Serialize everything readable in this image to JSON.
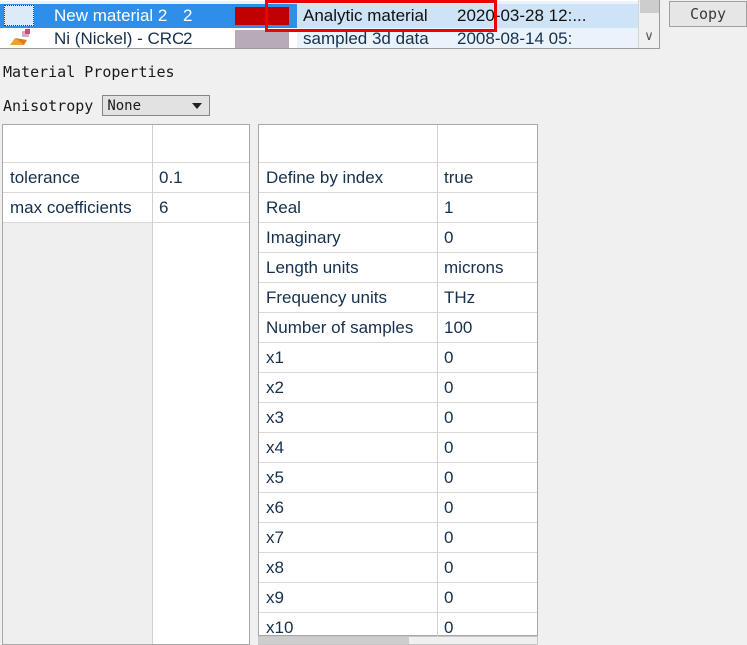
{
  "material_list": {
    "scroll": {
      "down_arrow_glyph": "∨"
    },
    "columns": [
      "icon",
      "name",
      "index",
      "color",
      "type",
      "date"
    ],
    "rows": [
      {
        "name": "New material 2",
        "index": "2",
        "color": "#c00000",
        "type": "Analytic material",
        "date": "2020-03-28 12:...",
        "selected": true
      },
      {
        "name": "Ni (Nickel) - CRC",
        "index": "2",
        "color": "#b9aab8",
        "type": "sampled 3d data",
        "date": "2008-08-14 05:",
        "selected": false
      }
    ]
  },
  "toolbar": {
    "copy_label": "Copy"
  },
  "annotation": {
    "color": "#ee0000",
    "targets": "Analytic material"
  },
  "section": {
    "title": "Material Properties"
  },
  "anisotropy": {
    "label": "Anisotropy",
    "value": "None",
    "options": [
      "None"
    ]
  },
  "fit_table": {
    "header_key": "",
    "header_value": "",
    "rows": [
      {
        "key": "tolerance",
        "value": "0.1"
      },
      {
        "key": "max coefficients",
        "value": "6"
      }
    ]
  },
  "analytic_table": {
    "header_key": "",
    "header_value": "",
    "rows": [
      {
        "key": "Define by index",
        "value": "true"
      },
      {
        "key": "Real",
        "value": "1"
      },
      {
        "key": "Imaginary",
        "value": "0"
      },
      {
        "key": "Length units",
        "value": "microns"
      },
      {
        "key": "Frequency units",
        "value": "THz"
      },
      {
        "key": "Number of samples",
        "value": "100"
      },
      {
        "key": "x1",
        "value": "0"
      },
      {
        "key": "x2",
        "value": "0"
      },
      {
        "key": "x3",
        "value": "0"
      },
      {
        "key": "x4",
        "value": "0"
      },
      {
        "key": "x5",
        "value": "0"
      },
      {
        "key": "x6",
        "value": "0"
      },
      {
        "key": "x7",
        "value": "0"
      },
      {
        "key": "x8",
        "value": "0"
      },
      {
        "key": "x9",
        "value": "0"
      },
      {
        "key": "x10",
        "value": "0"
      }
    ]
  }
}
